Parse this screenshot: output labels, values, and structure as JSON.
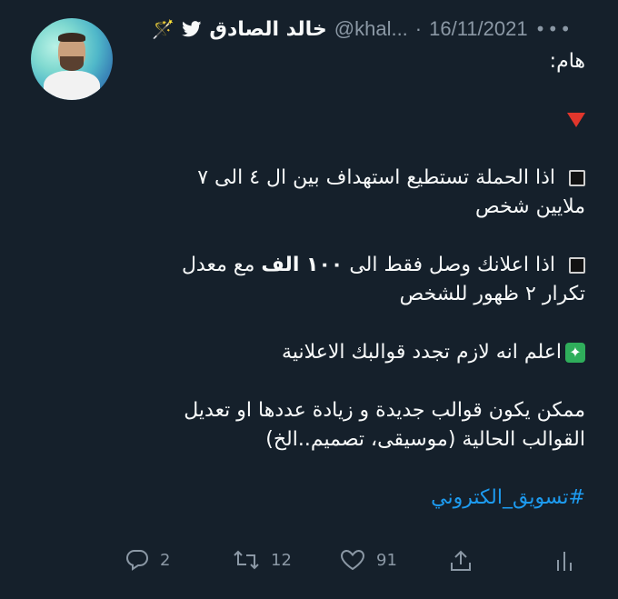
{
  "tweet": {
    "author_name": "خالد الصادق",
    "handle": "@khal...",
    "dot": "·",
    "date": "16/11/2021",
    "more": "•••",
    "wand": "🪄",
    "lines": [
      "هام:",
      "",
      "",
      "اذا الحملة تستطيع استهداف بين ال ٤ الى ٧",
      "ملايين شخص",
      "",
      "اذا اعلانك وصل فقط الى",
      "١٠٠ الف",
      "مع معدل",
      "تكرار ٢ ظهور للشخص",
      "",
      "اعلم انه لازم تجدد قوالبك الاعلانية",
      "",
      "ممكن يكون قوالب جديدة و زيادة عددها او تعديل",
      "القوالب الحالية (موسيقى، تصميم..الخ)",
      "",
      "#تسويق_الكتروني"
    ],
    "counts": {
      "replies": "2",
      "retweets": "12",
      "likes": "91"
    }
  },
  "colors": {
    "background": "#15202b",
    "text": "#f7f9f9",
    "muted": "#8b98a5",
    "link": "#1d9bf0"
  }
}
